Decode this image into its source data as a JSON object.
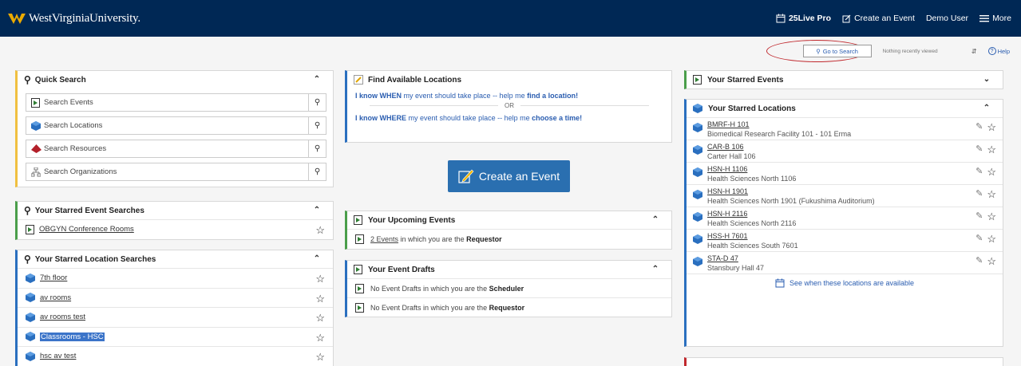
{
  "topbar": {
    "logo_text": "WestVirginiaUniversity.",
    "nav": [
      "25Live Pro",
      "Create an Event",
      "Demo User",
      "More"
    ]
  },
  "subbar": {
    "go_to_search": "Go to Search",
    "recent": "Nothing recently viewed",
    "help": "Help"
  },
  "quick_search": {
    "title": "Quick Search",
    "items": [
      "Search Events",
      "Search Locations",
      "Search Resources",
      "Search Organizations"
    ]
  },
  "starred_event_searches": {
    "title": "Your Starred Event Searches",
    "items": [
      "OBGYN Conference Rooms"
    ]
  },
  "starred_location_searches": {
    "title": "Your Starred Location Searches",
    "items": [
      "7th floor",
      "av rooms",
      "av rooms test",
      "Classrooms - HSC",
      "hsc av test"
    ]
  },
  "find_locations": {
    "title": "Find Available Locations",
    "line1_a": "I know WHEN",
    "line1_b": " my event should take place -- help me ",
    "line1_c": "find a location!",
    "or": "OR",
    "line2_a": "I know WHERE",
    "line2_b": " my event should take place -- help me ",
    "line2_c": "choose a time!"
  },
  "create_button": "Create an Event",
  "upcoming": {
    "title": "Your Upcoming Events",
    "link": "2 Events",
    "text": " in which you are the ",
    "role": "Requestor"
  },
  "drafts": {
    "title": "Your Event Drafts",
    "row1_text": "No Event Drafts in which you are the ",
    "row1_role": "Scheduler",
    "row2_text": "No Event Drafts in which you are the ",
    "row2_role": "Requestor"
  },
  "starred_events": {
    "title": "Your Starred Events"
  },
  "starred_locations": {
    "title": "Your Starred Locations",
    "items": [
      {
        "code": "BMRF-H 101",
        "name": "Biomedical Research Facility 101 - 101 Erma"
      },
      {
        "code": "CAR-B 106",
        "name": "Carter Hall 106"
      },
      {
        "code": "HSN-H 1106",
        "name": "Health Sciences North 1106"
      },
      {
        "code": "HSN-H 1901",
        "name": "Health Sciences North 1901 (Fukushima Auditorium)"
      },
      {
        "code": "HSN-H 2116",
        "name": "Health Sciences North 2116"
      },
      {
        "code": "HSS-H 7601",
        "name": "Health Sciences South 7601"
      },
      {
        "code": "STA-D 47",
        "name": "Stansbury Hall 47"
      }
    ],
    "availability": "See when these locations are available"
  },
  "colors": {
    "header": "#002855",
    "accent_blue": "#2a6fb0",
    "highlight": "#3b74c9"
  }
}
